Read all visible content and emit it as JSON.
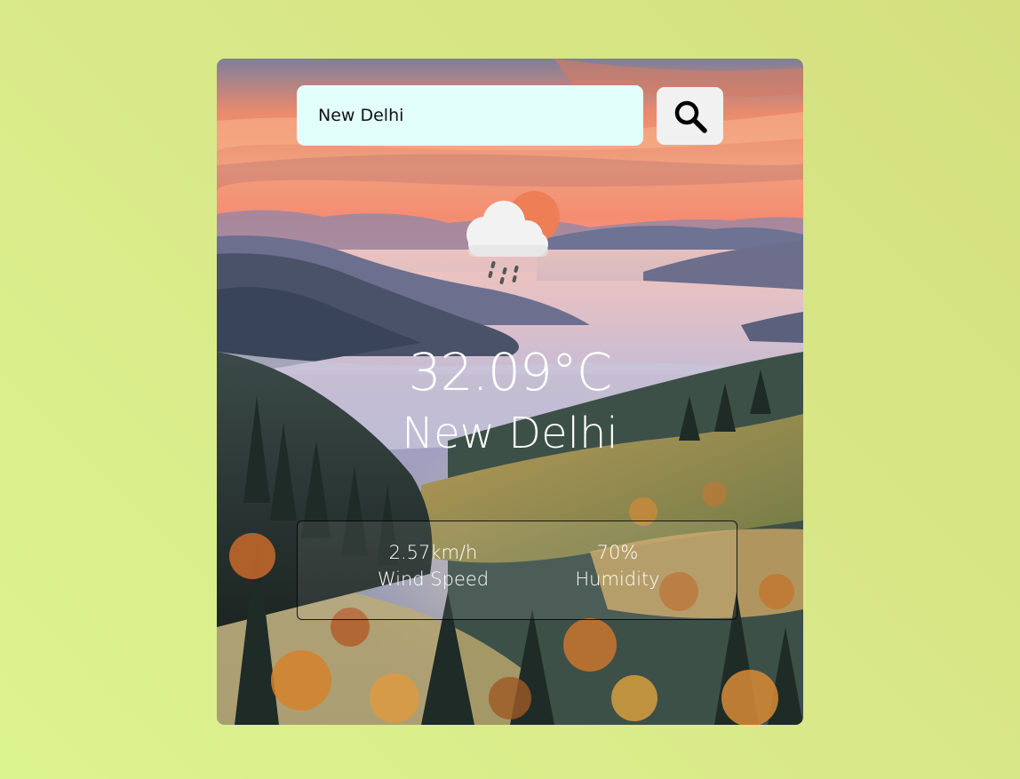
{
  "search": {
    "value": "New Delhi",
    "button_icon": "search-icon"
  },
  "weather": {
    "icon": "rain-cloud-sun-icon",
    "temperature": "32.09°C",
    "city": "New Delhi"
  },
  "details": {
    "wind_speed_value": "2.57km/h",
    "wind_speed_label": "Wind Speed",
    "humidity_value": "70%",
    "humidity_label": "Humidity"
  },
  "colors": {
    "page_background": "#d9e889",
    "search_input_background": "#e3fffb",
    "search_button_background": "#f1f1f1",
    "text": "#ffffff"
  }
}
